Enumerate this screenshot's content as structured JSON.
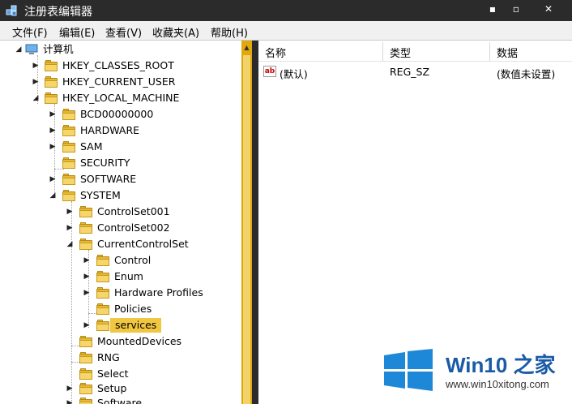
{
  "window": {
    "title": "注册表编辑器",
    "min": "▪",
    "max": "▫",
    "close": "✕"
  },
  "menu": [
    "文件(F)",
    "编辑(E)",
    "查看(V)",
    "收藏夹(A)",
    "帮助(H)"
  ],
  "tree": {
    "root": "计算机",
    "hkcr": "HKEY_CLASSES_ROOT",
    "hkcu": "HKEY_CURRENT_USER",
    "hklm": "HKEY_LOCAL_MACHINE",
    "bcd": "BCD00000000",
    "hardware": "HARDWARE",
    "sam": "SAM",
    "security": "SECURITY",
    "software": "SOFTWARE",
    "system": "SYSTEM",
    "cs001": "ControlSet001",
    "cs002": "ControlSet002",
    "ccs": "CurrentControlSet",
    "control": "Control",
    "enum": "Enum",
    "hwprofiles": "Hardware Profiles",
    "policies": "Policies",
    "services": "services",
    "mounted": "MountedDevices",
    "rng": "RNG",
    "select": "Select",
    "setup": "Setup",
    "software2": "Software"
  },
  "list": {
    "col_name": "名称",
    "col_type": "类型",
    "col_data": "数据",
    "row": {
      "name": "(默认)",
      "type": "REG_SZ",
      "data": "(数值未设置)"
    }
  },
  "watermark": {
    "brand": "Win10 之家",
    "url": "www.win10xitong.com"
  }
}
